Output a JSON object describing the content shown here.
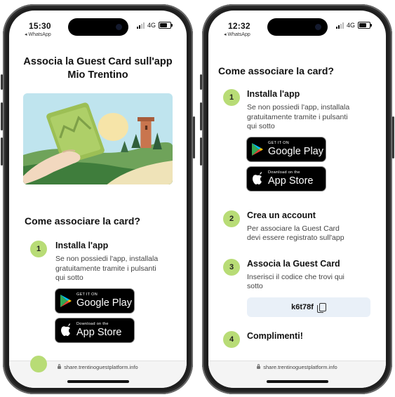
{
  "left_phone": {
    "status_bar": {
      "time": "15:30",
      "back_app": "◂ WhatsApp",
      "network": "4G"
    },
    "page_title": "Associa la Guest Card sull'app Mio Trentino",
    "section_title": "Come associare la card?",
    "steps": [
      {
        "number": "1",
        "title": "Installa l'app",
        "text": "Se non possiedi l'app, installala gratuitamente tramite i pulsanti qui sotto"
      }
    ],
    "google_play": {
      "small": "GET IT ON",
      "big": "Google Play"
    },
    "app_store": {
      "small": "Download on the",
      "big": "App Store"
    },
    "url": "share.trentinoguestplatform.info"
  },
  "right_phone": {
    "status_bar": {
      "time": "12:32",
      "back_app": "◂ WhatsApp",
      "network": "4G"
    },
    "section_title": "Come associare la card?",
    "steps": [
      {
        "number": "1",
        "title": "Installa l'app",
        "text": "Se non possiedi l'app, installala gratuitamente tramite i pulsanti qui sotto"
      },
      {
        "number": "2",
        "title": "Crea un account",
        "text": "Per associare la Guest Card devi essere registrato sull'app"
      },
      {
        "number": "3",
        "title": "Associa la Guest Card",
        "text": "Inserisci il codice che trovi qui sotto"
      },
      {
        "number": "4",
        "title": "Complimenti!",
        "text": ""
      }
    ],
    "google_play": {
      "small": "GET IT ON",
      "big": "Google Play"
    },
    "app_store": {
      "small": "Download on the",
      "big": "App Store"
    },
    "guest_code": "k6t78f",
    "url": "share.trentinoguestplatform.info"
  },
  "colors": {
    "accent_green": "#b8dc76",
    "code_box": "#e9f0f8"
  }
}
